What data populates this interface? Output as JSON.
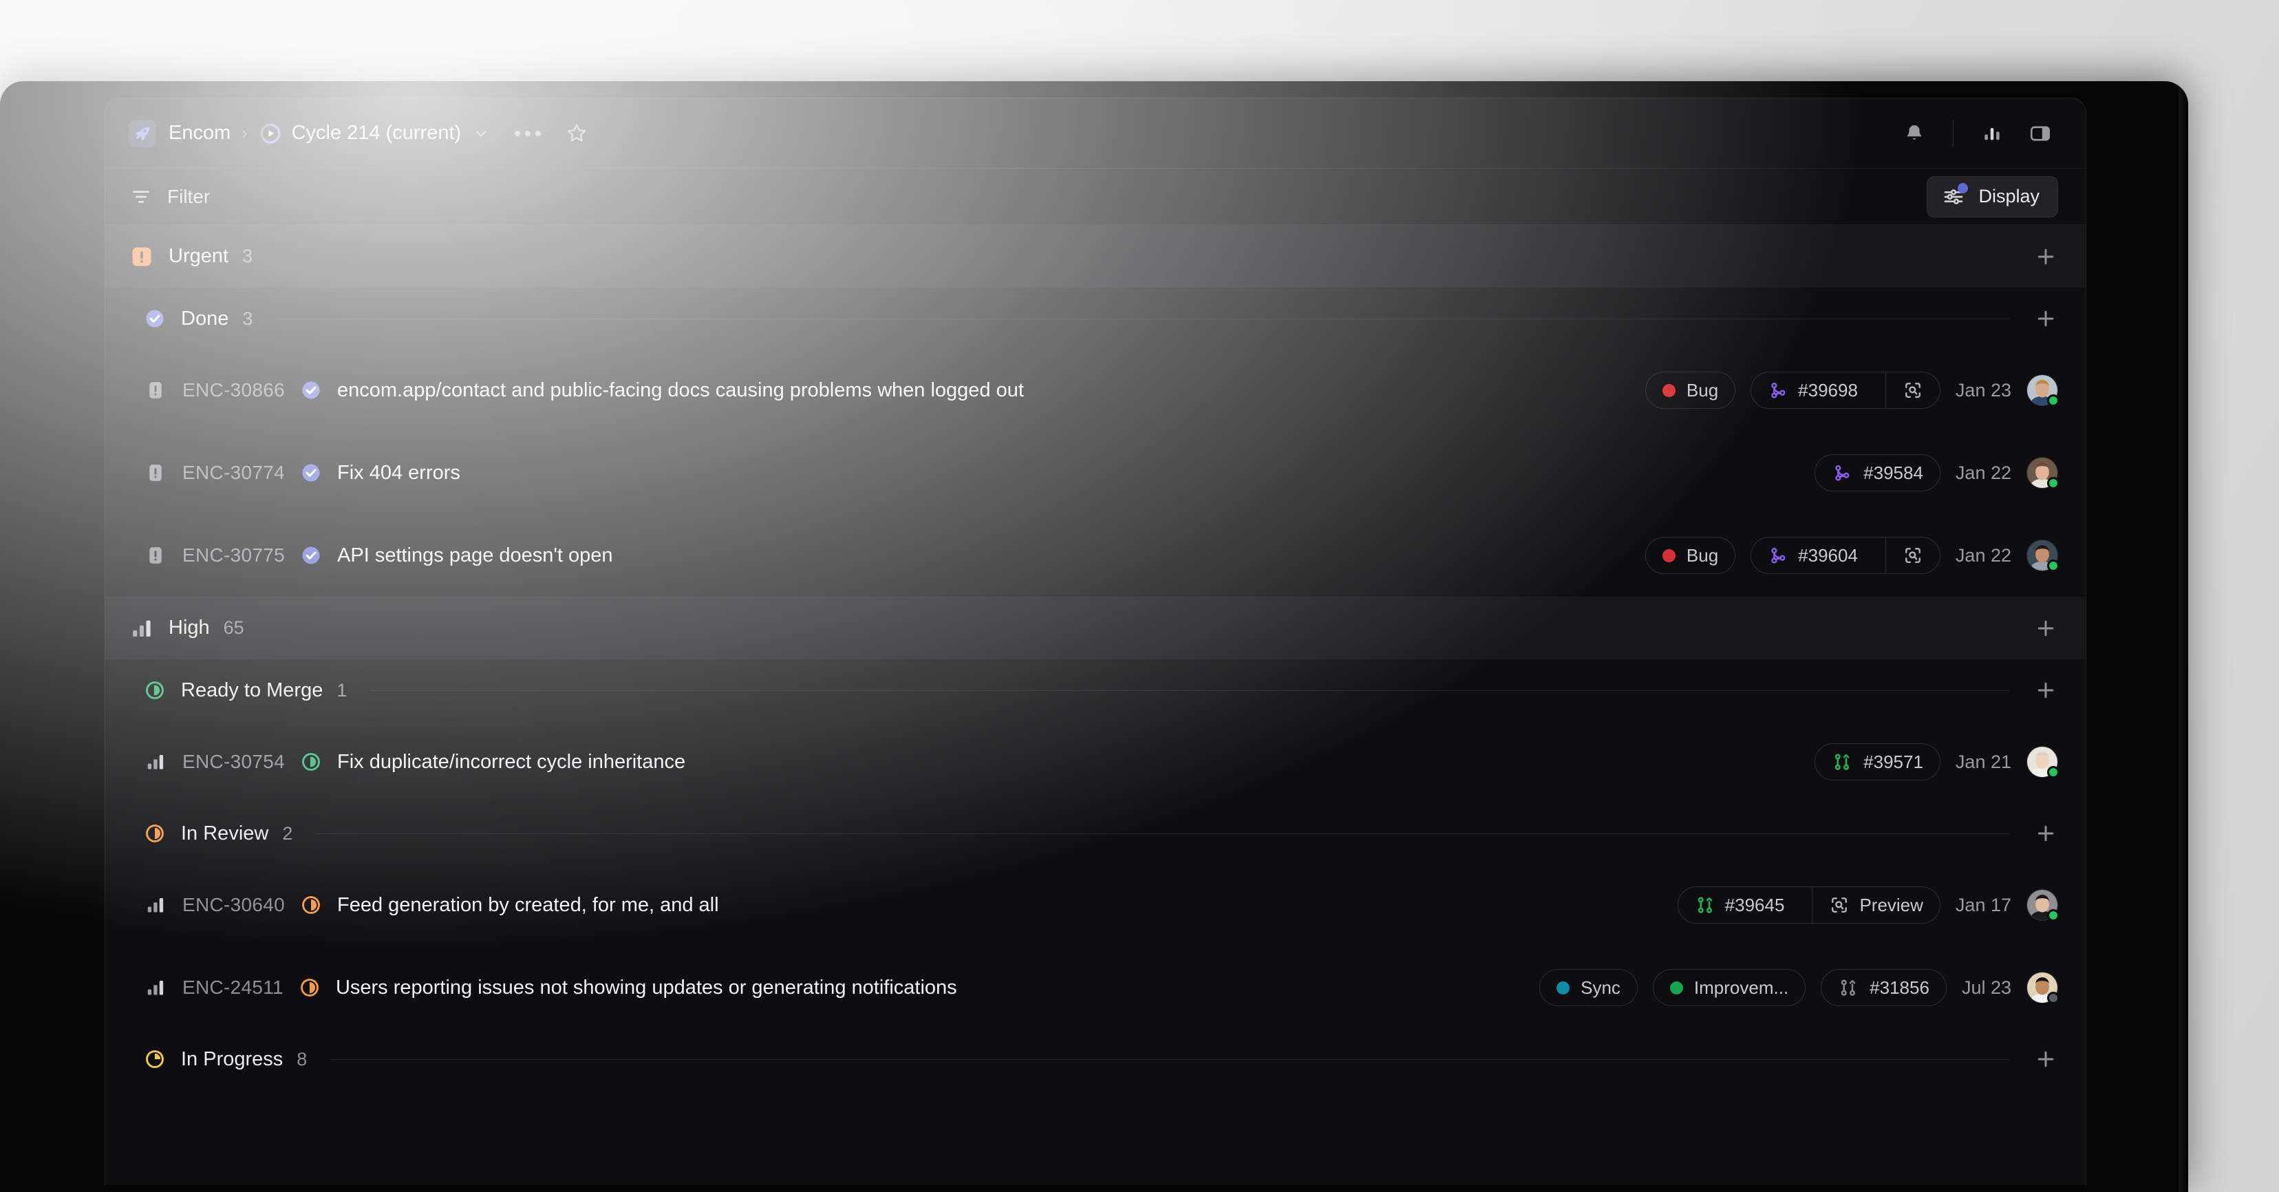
{
  "window": {
    "header": {
      "workspace": "Encom",
      "workspace_icon": "rocket-icon",
      "separator": "›",
      "cycle": "Cycle 214 (current)",
      "cycle_icon": "cycle-progress-icon",
      "dropdown_icon": "chevron-down-icon",
      "more_icon": "more-horizontal-icon",
      "favorite_icon": "star-icon",
      "notifications_icon": "bell-icon",
      "insights_icon": "bar-chart-icon",
      "panel_icon": "sidebar-panel-icon"
    },
    "toolbar": {
      "filter_label": "Filter",
      "filter_icon": "filter-icon",
      "display_label": "Display",
      "display_icon": "sliders-icon",
      "display_badge_color": "#5e6ad2",
      "add_icon": "plus-icon"
    }
  },
  "colors": {
    "accent": "#5e6ad2",
    "urgent": "#f2802a",
    "done": "#5e6ad2",
    "ready_to_merge": "#39b87a",
    "in_review": "#f2994a",
    "in_progress": "#f2c94c",
    "bug": "#d93036",
    "sync": "#0f8ba8",
    "improvement": "#16a34a",
    "pr_open": "#26b457",
    "pr_merged": "#8b5cf6",
    "pr_closed": "#8a8a92",
    "online": "#22c55e",
    "away": "#5c5c62"
  },
  "groups": [
    {
      "label": "Urgent",
      "count": "3",
      "icon": "priority-urgent-icon",
      "icon_color": "#f2802a",
      "sections": [
        {
          "label": "Done",
          "count": "3",
          "icon": "status-done-icon",
          "icon_color": "#5e6ad2",
          "issues": [
            {
              "priority_icon": "priority-urgent-small-icon",
              "id": "ENC-30866",
              "status_icon": "status-done-icon",
              "status_color": "#5e6ad2",
              "title": "encom.app/contact and public-facing docs causing problems when logged out",
              "labels": [
                {
                  "text": "Bug",
                  "color": "#d93036"
                }
              ],
              "pr": {
                "number": "#39698",
                "icon": "git-merge-icon",
                "color": "#8b5cf6",
                "preview": "",
                "preview_icon": "scan-icon"
              },
              "date": "Jan 23",
              "avatar": {
                "status": "online",
                "skin": "#d9a88a",
                "hair": "#b8893f",
                "shirt": "#2d4a6b",
                "bg": "#b9c4cc"
              }
            },
            {
              "priority_icon": "priority-urgent-small-icon",
              "id": "ENC-30774",
              "status_icon": "status-done-icon",
              "status_color": "#5e6ad2",
              "title": "Fix 404 errors",
              "labels": [],
              "pr": {
                "number": "#39584",
                "icon": "git-merge-icon",
                "color": "#8b5cf6",
                "preview": null,
                "preview_icon": null
              },
              "date": "Jan 22",
              "avatar": {
                "status": "online",
                "skin": "#e0b494",
                "hair": "#6b4a2f",
                "shirt": "#e8e4dc",
                "bg": "#6d5a46"
              }
            },
            {
              "priority_icon": "priority-urgent-small-icon",
              "id": "ENC-30775",
              "status_icon": "status-done-icon",
              "status_color": "#5e6ad2",
              "title": "API settings page doesn't open",
              "labels": [
                {
                  "text": "Bug",
                  "color": "#d93036"
                }
              ],
              "pr": {
                "number": "#39604",
                "icon": "git-merge-icon",
                "color": "#8b5cf6",
                "preview": "",
                "preview_icon": "scan-icon"
              },
              "date": "Jan 22",
              "avatar": {
                "status": "online",
                "skin": "#c98f6c",
                "hair": "#241a16",
                "shirt": "#9aa3ad",
                "bg": "#3c4a57"
              }
            }
          ]
        }
      ]
    },
    {
      "label": "High",
      "count": "65",
      "icon": "priority-high-icon",
      "icon_color": "#9a9aa2",
      "sections": [
        {
          "label": "Ready to Merge",
          "count": "1",
          "icon": "status-ready-icon",
          "icon_color": "#39b87a",
          "issues": [
            {
              "priority_icon": "priority-high-small-icon",
              "id": "ENC-30754",
              "status_icon": "status-ready-icon",
              "status_color": "#39b87a",
              "title": "Fix duplicate/incorrect cycle inheritance",
              "labels": [],
              "pr": {
                "number": "#39571",
                "icon": "git-pull-request-icon",
                "color": "#26b457",
                "preview": null,
                "preview_icon": null
              },
              "date": "Jan 21",
              "avatar": {
                "status": "online",
                "skin": "#f0d4bd",
                "hair": "#d8d2c8",
                "shirt": "#f4f2ee",
                "bg": "#e8e4de"
              }
            }
          ]
        },
        {
          "label": "In Review",
          "count": "2",
          "icon": "status-in-review-icon",
          "icon_color": "#f2994a",
          "issues": [
            {
              "priority_icon": "priority-high-small-icon",
              "id": "ENC-30640",
              "status_icon": "status-in-review-icon",
              "status_color": "#f2994a",
              "title": "Feed generation by created, for me, and all",
              "labels": [],
              "pr": {
                "number": "#39645",
                "icon": "git-pull-request-icon",
                "color": "#26b457",
                "preview": "Preview",
                "preview_icon": "scan-icon"
              },
              "date": "Jan 17",
              "avatar": {
                "status": "online",
                "skin": "#e3bda0",
                "hair": "#1c1512",
                "shirt": "#1b1b1f",
                "bg": "#8f8f93"
              }
            },
            {
              "priority_icon": "priority-high-small-icon",
              "id": "ENC-24511",
              "status_icon": "status-in-review-icon",
              "status_color": "#f2994a",
              "title": "Users reporting issues not showing updates or generating notifications",
              "labels": [
                {
                  "text": "Sync",
                  "color": "#0f8ba8"
                },
                {
                  "text": "Improvem...",
                  "color": "#16a34a"
                }
              ],
              "pr": {
                "number": "#31856",
                "icon": "git-pull-request-icon",
                "color": "#8a8a92",
                "preview": null,
                "preview_icon": null
              },
              "date": "Jul 23",
              "avatar": {
                "status": "away",
                "skin": "#c08a5e",
                "hair": "#181210",
                "shirt": "#f2f2f0",
                "bg": "#ded3b8"
              }
            }
          ]
        },
        {
          "label": "In Progress",
          "count": "8",
          "icon": "status-in-progress-icon",
          "icon_color": "#f2c94c",
          "issues": []
        }
      ]
    }
  ]
}
